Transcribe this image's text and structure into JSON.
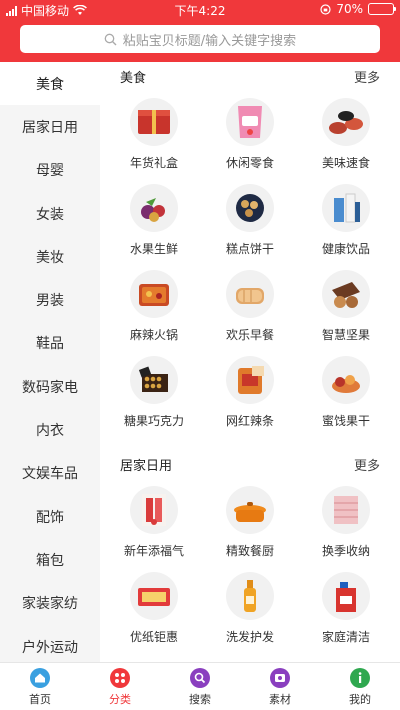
{
  "status": {
    "carrier": "中国移动",
    "time": "下午4:22",
    "battery": "70%",
    "battery_level": 0.7
  },
  "search": {
    "placeholder": "粘贴宝贝标题/输入关键字搜索"
  },
  "sidebar": {
    "items": [
      {
        "label": "美食",
        "active": true
      },
      {
        "label": "居家日用"
      },
      {
        "label": "母婴"
      },
      {
        "label": "女装"
      },
      {
        "label": "美妆"
      },
      {
        "label": "男装"
      },
      {
        "label": "鞋品"
      },
      {
        "label": "数码家电"
      },
      {
        "label": "内衣"
      },
      {
        "label": "文娱车品"
      },
      {
        "label": "配饰"
      },
      {
        "label": "箱包"
      },
      {
        "label": "家装家纺"
      },
      {
        "label": "户外运动"
      }
    ]
  },
  "sections": [
    {
      "title": "美食",
      "more": "更多",
      "items": [
        {
          "label": "年货礼盒",
          "icon": "gift-box-icon"
        },
        {
          "label": "休闲零食",
          "icon": "snack-bag-icon"
        },
        {
          "label": "美味速食",
          "icon": "noodle-bowls-icon"
        },
        {
          "label": "水果生鲜",
          "icon": "fruit-icon"
        },
        {
          "label": "糕点饼干",
          "icon": "cookies-icon"
        },
        {
          "label": "健康饮品",
          "icon": "drink-bottles-icon"
        },
        {
          "label": "麻辣火锅",
          "icon": "hotpot-icon"
        },
        {
          "label": "欢乐早餐",
          "icon": "bread-icon"
        },
        {
          "label": "智慧坚果",
          "icon": "nuts-icon"
        },
        {
          "label": "糖果巧克力",
          "icon": "chocolate-icon"
        },
        {
          "label": "网红辣条",
          "icon": "spicy-strips-icon"
        },
        {
          "label": "蜜饯果干",
          "icon": "dried-fruit-icon"
        }
      ]
    },
    {
      "title": "居家日用",
      "more": "更多",
      "items": [
        {
          "label": "新年添福气",
          "icon": "new-year-decor-icon"
        },
        {
          "label": "精致餐厨",
          "icon": "cooking-pot-icon"
        },
        {
          "label": "换季收纳",
          "icon": "storage-drawers-icon"
        },
        {
          "label": "优纸钜惠",
          "icon": "tissue-pack-icon"
        },
        {
          "label": "洗发护发",
          "icon": "shampoo-bottle-icon"
        },
        {
          "label": "家庭清洁",
          "icon": "detergent-bottle-icon"
        }
      ]
    }
  ],
  "tabbar": {
    "items": [
      {
        "label": "首页",
        "icon": "home-icon",
        "color": "#3aa0e0"
      },
      {
        "label": "分类",
        "icon": "category-icon",
        "color": "#f0383b",
        "active": true
      },
      {
        "label": "搜索",
        "icon": "search-icon",
        "color": "#8a3fbf"
      },
      {
        "label": "素材",
        "icon": "material-icon",
        "color": "#8a3fbf"
      },
      {
        "label": "我的",
        "icon": "profile-icon",
        "color": "#2fa84f"
      }
    ]
  },
  "colors": {
    "brand": "#f0383b",
    "sidebar_bg": "#f5f5f5"
  }
}
